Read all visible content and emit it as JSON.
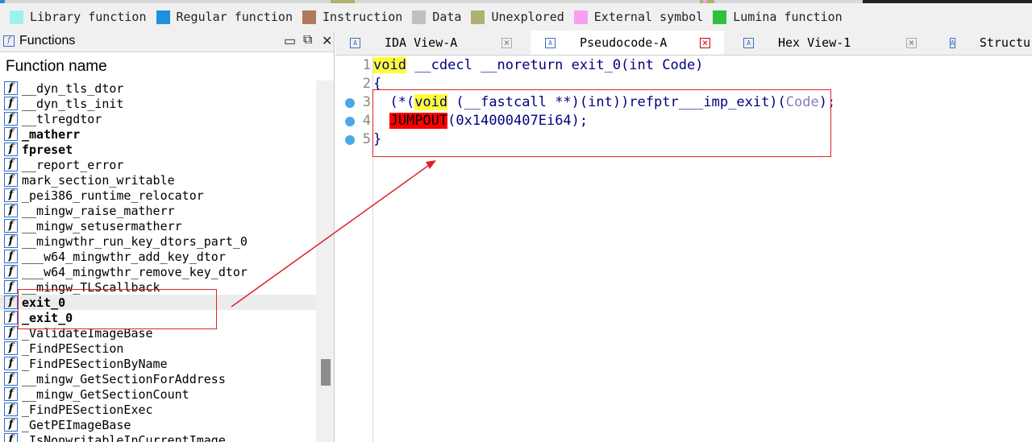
{
  "legend": [
    {
      "label": "Library function",
      "color": "#a0f0f0"
    },
    {
      "label": "Regular function",
      "color": "#1e90e0"
    },
    {
      "label": "Instruction",
      "color": "#b07a5c"
    },
    {
      "label": "Data",
      "color": "#c0c0c0"
    },
    {
      "label": "Unexplored",
      "color": "#b0b070"
    },
    {
      "label": "External symbol",
      "color": "#f8a0f0"
    },
    {
      "label": "Lumina function",
      "color": "#30c040"
    }
  ],
  "functions_panel": {
    "title": "Functions",
    "column_header": "Function name",
    "items": [
      {
        "name": "__dyn_tls_dtor",
        "bold": false
      },
      {
        "name": "__dyn_tls_init",
        "bold": false
      },
      {
        "name": "__tlregdtor",
        "bold": false
      },
      {
        "name": "_matherr",
        "bold": true
      },
      {
        "name": "fpreset",
        "bold": true
      },
      {
        "name": "__report_error",
        "bold": false
      },
      {
        "name": "mark_section_writable",
        "bold": false
      },
      {
        "name": "_pei386_runtime_relocator",
        "bold": false
      },
      {
        "name": "__mingw_raise_matherr",
        "bold": false
      },
      {
        "name": "__mingw_setusermatherr",
        "bold": false
      },
      {
        "name": "__mingwthr_run_key_dtors_part_0",
        "bold": false
      },
      {
        "name": "___w64_mingwthr_add_key_dtor",
        "bold": false
      },
      {
        "name": "___w64_mingwthr_remove_key_dtor",
        "bold": false
      },
      {
        "name": "__mingw_TLScallback",
        "bold": false
      },
      {
        "name": "exit_0",
        "bold": true,
        "selected": true
      },
      {
        "name": "_exit_0",
        "bold": true
      },
      {
        "name": "_ValidateImageBase",
        "bold": false
      },
      {
        "name": "_FindPESection",
        "bold": false
      },
      {
        "name": "_FindPESectionByName",
        "bold": false
      },
      {
        "name": "__mingw_GetSectionForAddress",
        "bold": false
      },
      {
        "name": "__mingw_GetSectionCount",
        "bold": false
      },
      {
        "name": "_FindPESectionExec",
        "bold": false
      },
      {
        "name": "_GetPEImageBase",
        "bold": false
      },
      {
        "name": "_IsNonwritableInCurrentImage",
        "bold": false
      }
    ]
  },
  "tabs": [
    {
      "label": "IDA View-A",
      "active": false
    },
    {
      "label": "Pseudocode-A",
      "active": true
    },
    {
      "label": "Hex View-1",
      "active": false
    },
    {
      "label": "Structure",
      "active": false
    }
  ],
  "code": {
    "lines": [
      {
        "num": "1",
        "segments": [
          {
            "t": "void",
            "c": "hl"
          },
          {
            "t": " __cdecl __noreturn exit_0(int Code)",
            "c": ""
          }
        ]
      },
      {
        "num": "2",
        "segments": [
          {
            "t": "{",
            "c": ""
          }
        ]
      },
      {
        "num": "3",
        "bp": true,
        "segments": [
          {
            "t": "  (*(",
            "c": ""
          },
          {
            "t": "void",
            "c": "hl"
          },
          {
            "t": " (__fastcall **)(int))refptr___imp_exit)(",
            "c": ""
          },
          {
            "t": "Code",
            "c": "dim"
          },
          {
            "t": ");",
            "c": ""
          }
        ]
      },
      {
        "num": "4",
        "bp": true,
        "segments": [
          {
            "t": "  ",
            "c": ""
          },
          {
            "t": "JUMPOUT",
            "c": "red"
          },
          {
            "t": "(0x14000407Ei64);",
            "c": ""
          }
        ]
      },
      {
        "num": "5",
        "bp": true,
        "segments": [
          {
            "t": "}",
            "c": ""
          }
        ]
      }
    ]
  },
  "colors": {
    "annotation": "#e0202a",
    "selection": "#ececec",
    "breakpoint": "#4aa8e8"
  }
}
